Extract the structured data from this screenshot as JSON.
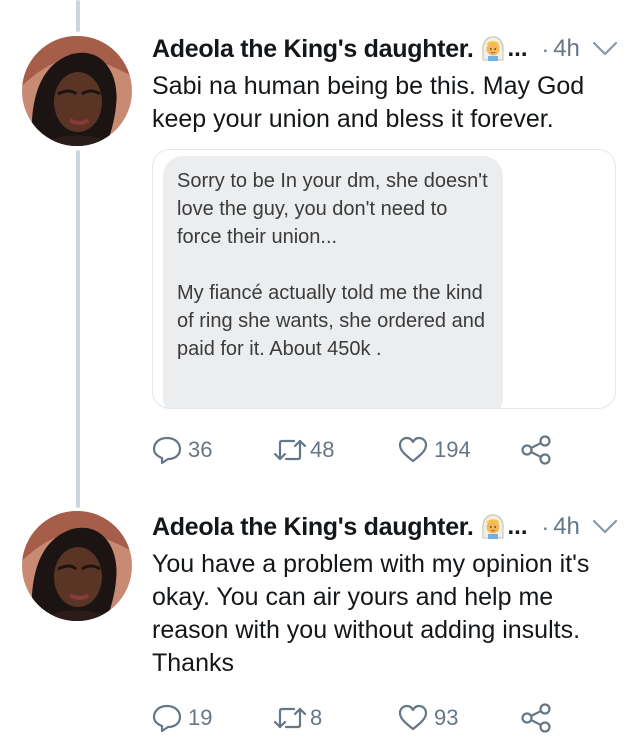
{
  "tweets": [
    {
      "author_name": "Adeola the King's daughter.",
      "truncation": "...",
      "separator": "·",
      "time": "4h",
      "text": "Sabi na human being be this. May God keep your union and bless it forever.",
      "quoted_message": {
        "para1": "Sorry to be In your dm, she doesn't love the guy, you don't need to force their union...",
        "para2": "My fiancé actually told me the kind of ring she wants, she ordered and paid for it.  About 450k ."
      },
      "replies": "36",
      "retweets": "48",
      "likes": "194"
    },
    {
      "author_name": "Adeola the King's daughter.",
      "truncation": "...",
      "separator": "·",
      "time": "4h",
      "text": "You have a problem with my opinion it's okay. You can air yours and help me reason with you without adding insults. Thanks",
      "replies": "19",
      "retweets": "8",
      "likes": "93"
    }
  ],
  "icons": {
    "reply": "reply-icon",
    "retweet": "retweet-icon",
    "like": "heart-icon",
    "share": "share-icon",
    "more": "chevron-down-icon",
    "emoji": "woman-with-veil-emoji"
  },
  "colors": {
    "text": "#14171a",
    "muted": "#657786",
    "thread_line": "#ccd6dd",
    "bubble": "#ebedef"
  }
}
